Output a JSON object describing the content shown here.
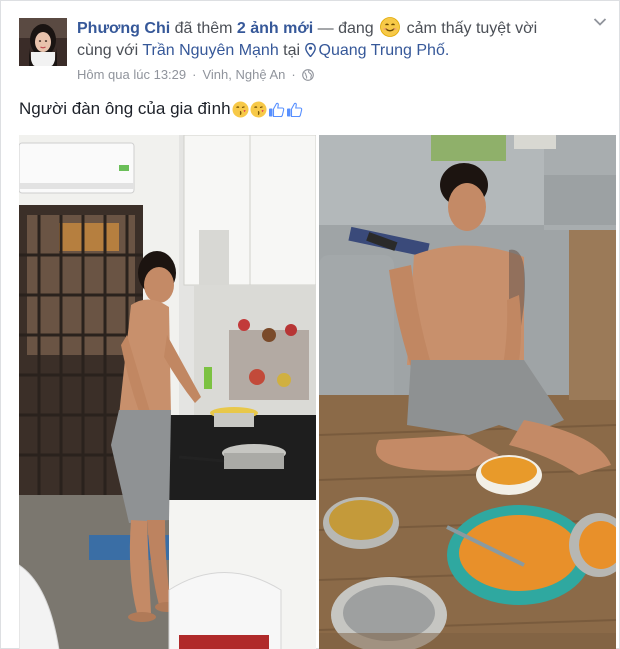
{
  "post": {
    "author_name": "Phương Chi",
    "action_text": "đã thêm",
    "photo_count_text": "2 ảnh mới",
    "dash_text": "— đang",
    "feeling_text": "cảm thấy tuyệt vời",
    "with_text": "cùng với",
    "tagged_person": "Trần Nguyên Mạnh",
    "at_text": "tại",
    "location": "Quang Trung Phố.",
    "timestamp": "Hôm qua lúc 13:29",
    "place": "Vinh, Nghệ An",
    "separator": "·",
    "caption": "Người đàn ông của gia đình"
  },
  "icons": {
    "feeling": "smiling-face-icon",
    "location": "map-pin-icon",
    "privacy": "globe-icon",
    "menu": "chevron-down-icon",
    "caption_emojis": [
      "kiss-face-icon",
      "kiss-face-icon",
      "thumbs-up-icon",
      "thumbs-up-icon"
    ]
  },
  "colors": {
    "link": "#365899",
    "meta": "#90949c",
    "text": "#1d2129"
  }
}
